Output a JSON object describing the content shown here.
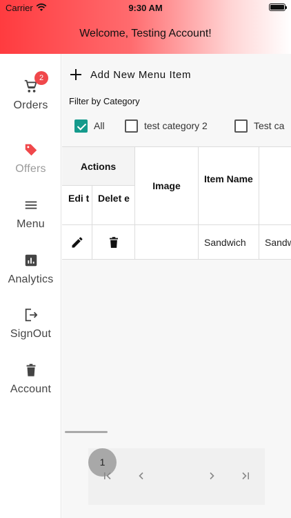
{
  "status_bar": {
    "carrier": "Carrier",
    "time": "9:30 AM"
  },
  "header": {
    "welcome": "Welcome, Testing Account!"
  },
  "sidebar": {
    "items": [
      {
        "label": "Orders",
        "icon": "cart-icon",
        "badge": "2"
      },
      {
        "label": "Offers",
        "icon": "tag-icon"
      },
      {
        "label": "Menu",
        "icon": "menu-icon"
      },
      {
        "label": "Analytics",
        "icon": "analytics-icon"
      },
      {
        "label": "SignOut",
        "icon": "sign-out-icon"
      },
      {
        "label": "Account",
        "icon": "trash-icon"
      }
    ]
  },
  "main": {
    "add_label": "Add New Menu Item",
    "filter_title": "Filter by Category",
    "categories": [
      {
        "label": "All",
        "checked": true
      },
      {
        "label": "test category 2",
        "checked": false
      },
      {
        "label": "Test ca",
        "checked": false
      }
    ],
    "table": {
      "actions": "Actions",
      "edit": "Edi t",
      "delete": "Delet e",
      "image": "Image",
      "item_name": "Item Name",
      "rows": [
        {
          "name": "Sandwich",
          "extra": "Sandw"
        }
      ]
    },
    "pagination": {
      "current_page": "1"
    }
  },
  "colors": {
    "accent": "#ff3b3f",
    "badge": "#f0484b",
    "checkbox": "#159a8c"
  }
}
